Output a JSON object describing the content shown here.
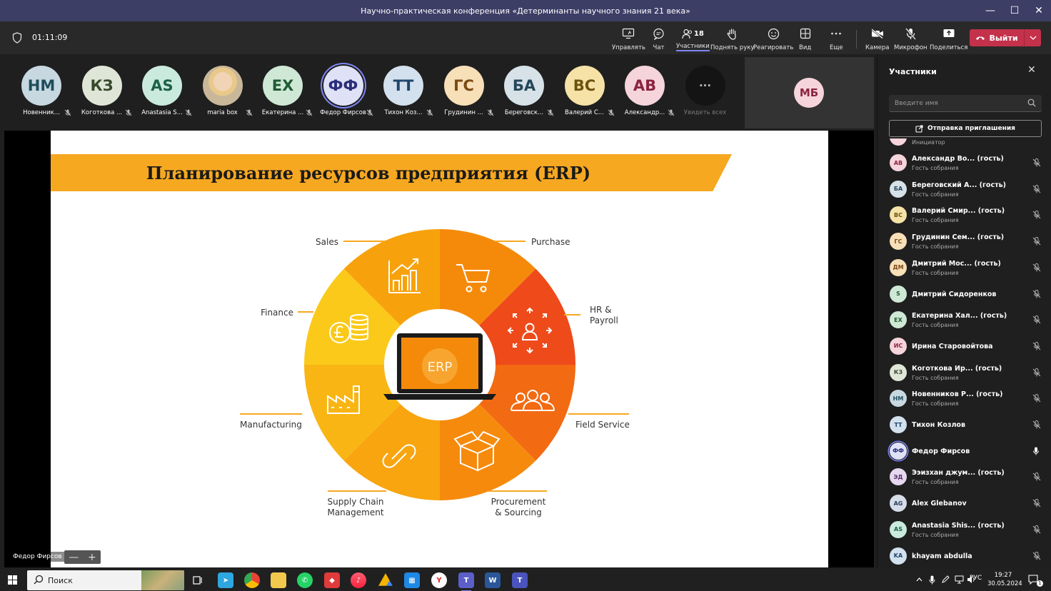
{
  "window": {
    "title": "Научно-практическая конференция «Детерминанты научного знания 21 века»",
    "controls": [
      "—",
      "☐",
      "✕"
    ]
  },
  "toolbar": {
    "timer": "01:11:09",
    "buttons": [
      {
        "id": "manage",
        "label": "Управлять",
        "icon": "share-screen-icon"
      },
      {
        "id": "chat",
        "label": "Чат",
        "icon": "chat-icon"
      },
      {
        "id": "people",
        "label": "Участники",
        "icon": "people-icon",
        "count": "18",
        "active": true
      },
      {
        "id": "raise-hand",
        "label": "Поднять руку",
        "icon": "hand-icon"
      },
      {
        "id": "react",
        "label": "Реагировать",
        "icon": "smile-icon"
      },
      {
        "id": "view",
        "label": "Вид",
        "icon": "grid-icon"
      },
      {
        "id": "more",
        "label": "Еще",
        "icon": "more-icon"
      },
      {
        "id": "camera",
        "label": "Камера",
        "icon": "camera-off-icon"
      },
      {
        "id": "mic",
        "label": "Микрофон",
        "icon": "mic-off-icon"
      },
      {
        "id": "share",
        "label": "Поделиться",
        "icon": "share-up-icon"
      }
    ],
    "leave_label": "Выйти"
  },
  "gallery": [
    {
      "initials": "НМ",
      "name": "Новенник...",
      "bg": "#c7d8e0",
      "fg": "#1f4d5e"
    },
    {
      "initials": "КЗ",
      "name": "Коготкова ...",
      "bg": "#dfe6d8",
      "fg": "#374a2b"
    },
    {
      "initials": "AS",
      "name": "Anastasia S...",
      "bg": "#c9eadc",
      "fg": "#1c6048"
    },
    {
      "initials": "",
      "name": "maria box",
      "bg": "#e0c8a8",
      "fg": "#333",
      "photo": true
    },
    {
      "initials": "ЕХ",
      "name": "Екатерина ...",
      "bg": "#cfe8d6",
      "fg": "#1f5a33"
    },
    {
      "initials": "ФФ",
      "name": "Федор Фирсов",
      "bg": "#dfe2f7",
      "fg": "#2b2f7a",
      "speaking": true
    },
    {
      "initials": "ТТ",
      "name": "Тихон Коз...",
      "bg": "#d3e0ee",
      "fg": "#20456b"
    },
    {
      "initials": "ГС",
      "name": "Грудинин ...",
      "bg": "#f7dfb8",
      "fg": "#7a4a12"
    },
    {
      "initials": "БА",
      "name": "Береговск...",
      "bg": "#d6e2e8",
      "fg": "#24475a"
    },
    {
      "initials": "ВС",
      "name": "Валерий С...",
      "bg": "#f6e2a6",
      "fg": "#6b5310"
    },
    {
      "initials": "АВ",
      "name": "Александр...",
      "bg": "#f6d4dc",
      "fg": "#8a2440"
    }
  ],
  "see_all": {
    "label": "Увидеть всех",
    "glyph": "···"
  },
  "self_view": {
    "initials": "МБ"
  },
  "slide": {
    "title": "Планирование ресурсов предприятия (ERP)",
    "center": "ERP",
    "segments": [
      "Sales",
      "Purchase",
      "HR &\nPayroll",
      "Field Service",
      "Procurement\n& Sourcing",
      "Supply Chain\nManagement",
      "Manufacturing",
      "Finance"
    ],
    "colors": {
      "sales": "#f7a20c",
      "purchase": "#f58a0a",
      "hr": "#ee4a1a",
      "field": "#f26a12",
      "procurement": "#f68a0c",
      "supply": "#f8a510",
      "manufacturing": "#f9b513",
      "finance": "#fbc91a"
    }
  },
  "presenter": {
    "name": "Федор Фирсов",
    "zoom_out": "—",
    "zoom_in": "+"
  },
  "panel": {
    "title": "Участники",
    "search_placeholder": "Введите имя",
    "invite_label": "Отправка приглашения",
    "partial_role": "Инициатор",
    "participants": [
      {
        "initials": "АВ",
        "name": "Александр Во... (гость)",
        "role": "Гость собрания",
        "bg": "#f6d4dc",
        "fg": "#8a2440",
        "mic": "off"
      },
      {
        "initials": "БА",
        "name": "Береговский А... (гость)",
        "role": "Гость собрания",
        "bg": "#d6e2e8",
        "fg": "#24475a",
        "mic": "off"
      },
      {
        "initials": "ВС",
        "name": "Валерий Смир... (гость)",
        "role": "Гость собрания",
        "bg": "#f6e2a6",
        "fg": "#6b5310",
        "mic": "off"
      },
      {
        "initials": "ГС",
        "name": "Грудинин Сем... (гость)",
        "role": "Гость собрания",
        "bg": "#f7dfb8",
        "fg": "#7a4a12",
        "mic": "off"
      },
      {
        "initials": "ДМ",
        "name": "Дмитрий Мос... (гость)",
        "role": "Гость собрания",
        "bg": "#f7dfb8",
        "fg": "#7a4a12",
        "mic": "off"
      },
      {
        "initials": "S",
        "name": "Дмитрий Сидоренков",
        "role": "",
        "bg": "#cfe8d6",
        "fg": "#1f5a33",
        "mic": "off"
      },
      {
        "initials": "ЕХ",
        "name": "Екатерина Хал... (гость)",
        "role": "Гость собрания",
        "bg": "#cfe8d6",
        "fg": "#1f5a33",
        "mic": "off"
      },
      {
        "initials": "ИС",
        "name": "Ирина Старовойтова",
        "role": "",
        "bg": "#f6d4dc",
        "fg": "#8a2440",
        "mic": "off"
      },
      {
        "initials": "КЗ",
        "name": "Коготкова Ир... (гость)",
        "role": "Гость собрания",
        "bg": "#dfe6d8",
        "fg": "#374a2b",
        "mic": "off"
      },
      {
        "initials": "НМ",
        "name": "Новенников Р... (гость)",
        "role": "Гость собрания",
        "bg": "#c7d8e0",
        "fg": "#1f4d5e",
        "mic": "off"
      },
      {
        "initials": "ТТ",
        "name": "Тихон Козлов",
        "role": "",
        "bg": "#d3e0ee",
        "fg": "#20456b",
        "mic": "off"
      },
      {
        "initials": "ФФ",
        "name": "Федор Фирсов",
        "role": "",
        "bg": "#dfe2f7",
        "fg": "#2b2f7a",
        "mic": "on",
        "speaking": true
      },
      {
        "initials": "ЭД",
        "name": "Ээизхан джум... (гость)",
        "role": "Гость собрания",
        "bg": "#e6d8ee",
        "fg": "#55306b",
        "mic": "off"
      },
      {
        "initials": "AG",
        "name": "Alex Glebanov",
        "role": "",
        "bg": "#d6dde8",
        "fg": "#2a3c5a",
        "mic": "off"
      },
      {
        "initials": "AS",
        "name": "Anastasia Shis... (гость)",
        "role": "Гость собрания",
        "bg": "#c9eadc",
        "fg": "#1c6048",
        "mic": "off"
      },
      {
        "initials": "KA",
        "name": "khayam abdulla",
        "role": "",
        "bg": "#d3e0ee",
        "fg": "#20456b",
        "mic": "off"
      }
    ]
  },
  "taskbar": {
    "search_placeholder": "Поиск",
    "lang": "РУС",
    "time": "19:27",
    "date": "30.05.2024",
    "notification_count": "1"
  }
}
